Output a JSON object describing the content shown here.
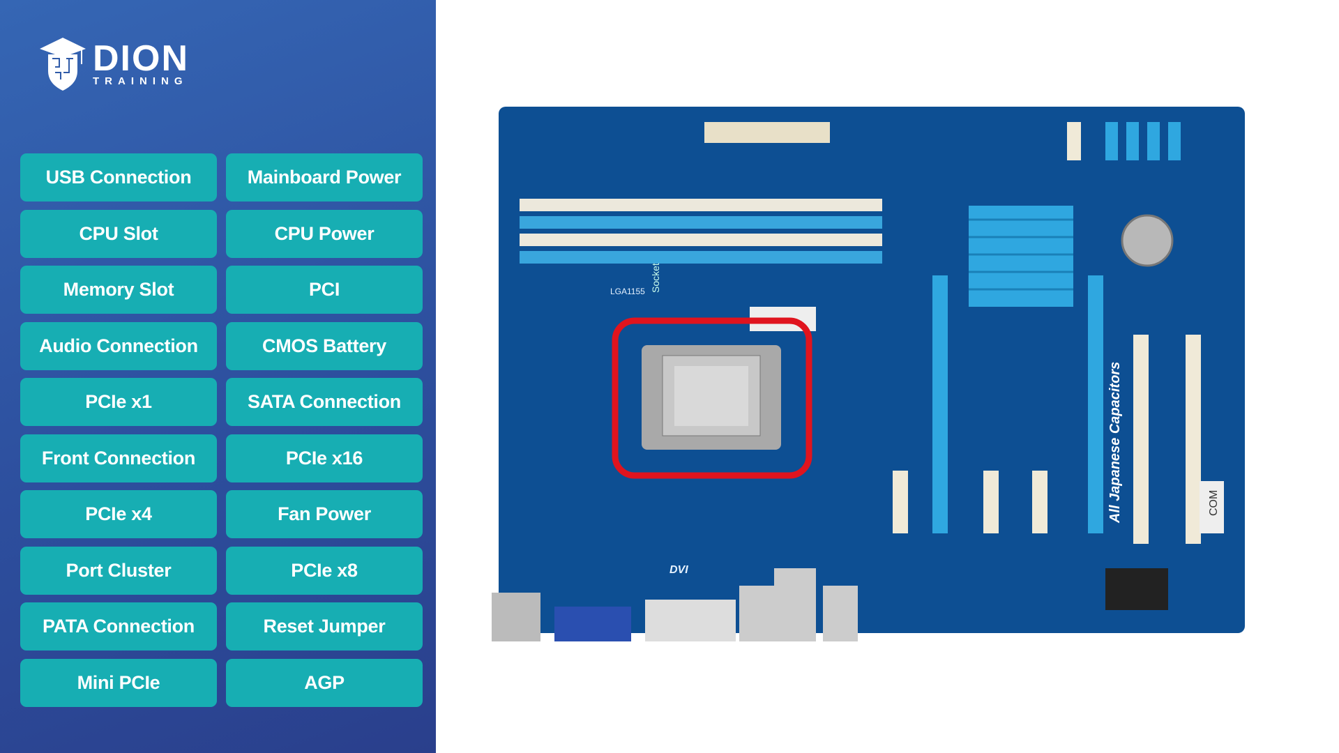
{
  "logo": {
    "brand": "DION",
    "sub": "TRAINING"
  },
  "options": [
    "USB Connection",
    "Mainboard Power",
    "CPU Slot",
    "CPU Power",
    "Memory Slot",
    "PCI",
    "Audio Connection",
    "CMOS Battery",
    "PCIe x1",
    "SATA Connection",
    "Front Connection",
    "PCIe x16",
    "PCIe x4",
    "Fan Power",
    "Port Cluster",
    "PCIe x8",
    "PATA Connection",
    "Reset Jumper",
    "Mini PCIe",
    "AGP"
  ],
  "board": {
    "highlight_color": "#e0141e",
    "pcb_color": "#0d4f93",
    "silkscreen": [
      "Socket",
      "All Japanese Capacitors",
      "LGA1155",
      "COM",
      "DVI"
    ]
  }
}
